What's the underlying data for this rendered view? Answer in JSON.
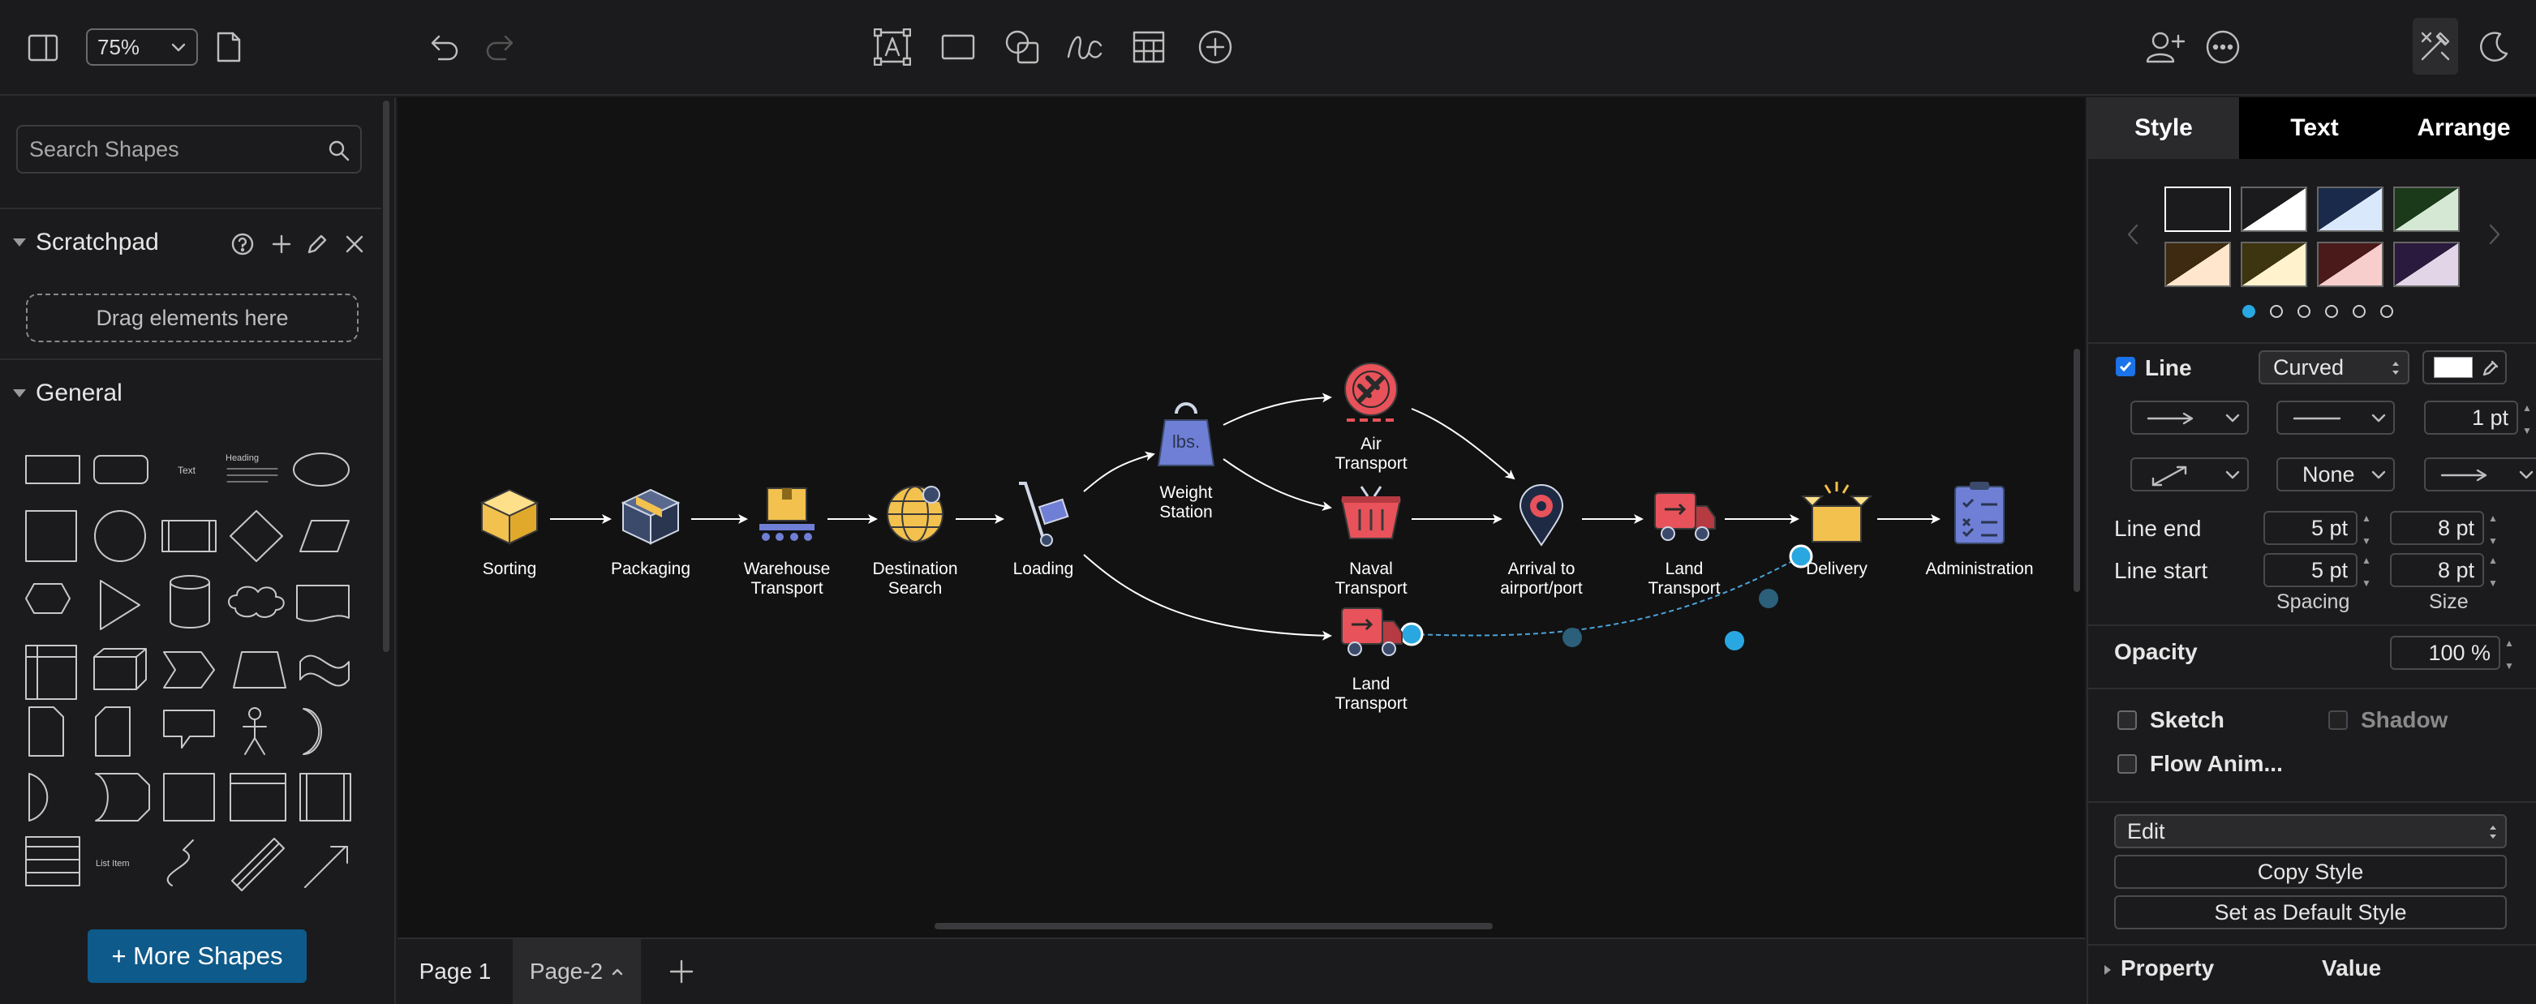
{
  "toolbar": {
    "zoom": "75%",
    "icons": [
      "format-panel-icon",
      "page-icon",
      "undo-icon",
      "redo-icon",
      "text-icon",
      "rectangle-icon",
      "shapes-icon",
      "freehand-icon",
      "table-icon",
      "insert-icon",
      "share-icon",
      "more-icon",
      "edit-style-icon",
      "dark-mode-icon"
    ]
  },
  "left": {
    "search_placeholder": "Search Shapes",
    "scratchpad": {
      "title": "Scratchpad",
      "drop_hint": "Drag elements here"
    },
    "general": {
      "title": "General",
      "text_shape": "Text",
      "heading_shape": "Heading",
      "list_item": "List Item"
    },
    "more_shapes": "+ More Shapes"
  },
  "diagram": {
    "nodes": [
      {
        "id": "sorting",
        "label": [
          "Sorting"
        ],
        "icon": "box-icon",
        "color": "#f2c14e"
      },
      {
        "id": "packaging",
        "label": [
          "Packaging"
        ],
        "icon": "package-icon",
        "color": "#3b4a6b"
      },
      {
        "id": "warehouse",
        "label": [
          "Warehouse",
          "Transport"
        ],
        "icon": "conveyor-icon",
        "color": "#f2c14e"
      },
      {
        "id": "destination",
        "label": [
          "Destination",
          "Search"
        ],
        "icon": "globe-icon",
        "color": "#f2c14e"
      },
      {
        "id": "loading",
        "label": [
          "Loading"
        ],
        "icon": "hand-truck-icon",
        "color": "#6f7fd6"
      },
      {
        "id": "weight",
        "label": [
          "Weight",
          "Station"
        ],
        "icon": "weight-icon",
        "color": "#6f7fd6"
      },
      {
        "id": "air",
        "label": [
          "Air",
          "Transport"
        ],
        "icon": "airplane-icon",
        "color": "#e8525a"
      },
      {
        "id": "naval",
        "label": [
          "Naval",
          "Transport"
        ],
        "icon": "ship-icon",
        "color": "#e8525a"
      },
      {
        "id": "land2",
        "label": [
          "Land",
          "Transport"
        ],
        "icon": "truck-icon",
        "color": "#e8525a"
      },
      {
        "id": "arrival",
        "label": [
          "Arrival to",
          "airport/port"
        ],
        "icon": "location-pin-icon",
        "color": "#e8525a"
      },
      {
        "id": "land1",
        "label": [
          "Land",
          "Transport"
        ],
        "icon": "truck-icon",
        "color": "#e8525a"
      },
      {
        "id": "delivery",
        "label": [
          "Delivery"
        ],
        "icon": "open-box-icon",
        "color": "#f2c14e"
      },
      {
        "id": "admin",
        "label": [
          "Administration"
        ],
        "icon": "clipboard-icon",
        "color": "#6f7fd6"
      }
    ]
  },
  "pages": {
    "tabs": [
      "Page 1",
      "Page-2"
    ],
    "active": "Page-2",
    "add_icon": "plus-icon"
  },
  "format": {
    "tabs": [
      "Style",
      "Text",
      "Arrange"
    ],
    "line_label": "Line",
    "line_style": "Curved",
    "line_width": "1 pt",
    "arrow_none": "None",
    "line_end_label": "Line end",
    "line_start_label": "Line start",
    "line_end_spacing": "5 pt",
    "line_end_size": "8 pt",
    "line_start_spacing": "5 pt",
    "line_start_size": "8 pt",
    "spacing_label": "Spacing",
    "size_label": "Size",
    "opacity_label": "Opacity",
    "opacity_value": "100 %",
    "sketch_label": "Sketch",
    "shadow_label": "Shadow",
    "flow_label": "Flow Anim...",
    "edit_select": "Edit",
    "copy_style": "Copy Style",
    "default_style": "Set as Default Style",
    "property_label": "Property",
    "value_label": "Value",
    "swatches": [
      [
        "#1b1b1d",
        "#1b1b1d"
      ],
      [
        "#1b1b1d",
        "#ffffff"
      ],
      [
        "#1a2a4a",
        "#dae8fc"
      ],
      [
        "#1a3a1a",
        "#d5e8d4"
      ],
      [
        "#3d2a10",
        "#ffe6cc"
      ],
      [
        "#3d3410",
        "#fff2cc"
      ],
      [
        "#4a1a1a",
        "#f8cecc"
      ],
      [
        "#2a1a3d",
        "#e1d5e7"
      ]
    ]
  }
}
